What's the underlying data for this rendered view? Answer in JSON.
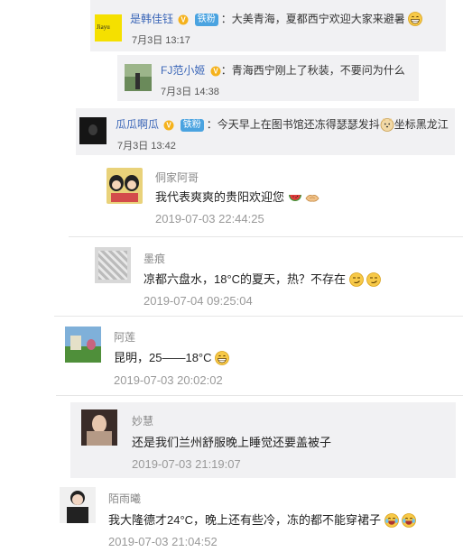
{
  "weibo_replies": [
    {
      "name": "是韩佳钰",
      "badge": "铁粉",
      "text": "大美青海，夏都西宁欢迎大家来避暑",
      "time": "7月3日 13:17",
      "emoji": [
        "grin"
      ]
    },
    {
      "name": "FJ范小姬",
      "badge": "",
      "text": "青海西宁刚上了秋装，不要问为什么",
      "time": "7月3日 14:38",
      "emoji": []
    },
    {
      "name": "瓜瓜啊瓜",
      "badge": "铁粉",
      "text": "今天早上在图书馆还冻得瑟瑟发抖",
      "text_tail": "坐标黑龙江",
      "time": "7月3日 13:42",
      "emoji": [
        "doge"
      ]
    }
  ],
  "comments": [
    {
      "name": "侗家阿哥",
      "text": "我代表爽爽的贵阳欢迎您",
      "time": "2019-07-03 22:44:25",
      "emoji": [
        "watermelon",
        "handshake"
      ]
    },
    {
      "name": "墨痕",
      "text": "凉都六盘水，18°C的夏天，热？不存在",
      "time": "2019-07-04 09:25:04",
      "emoji": [
        "smirk",
        "smirk"
      ]
    },
    {
      "name": "阿莲",
      "text": "昆明，25——18°C",
      "time": "2019-07-03 20:02:02",
      "emoji": [
        "grin"
      ]
    },
    {
      "name": "妙慧",
      "text": "还是我们兰州舒服晚上睡觉还要盖被子",
      "time": "2019-07-03 21:19:07",
      "emoji": []
    },
    {
      "name": "陌雨曦",
      "text": "我大隆德才24°C，晚上还有些冷，冻的都不能穿裙子",
      "time": "2019-07-03 21:04:52",
      "emoji": [
        "laugh-cry",
        "laugh-cry"
      ]
    }
  ],
  "colors": {
    "link": "#3c67b8",
    "badge": "#4aa3e0",
    "card_bg": "#f1f1f3",
    "time_gray": "#999999"
  }
}
